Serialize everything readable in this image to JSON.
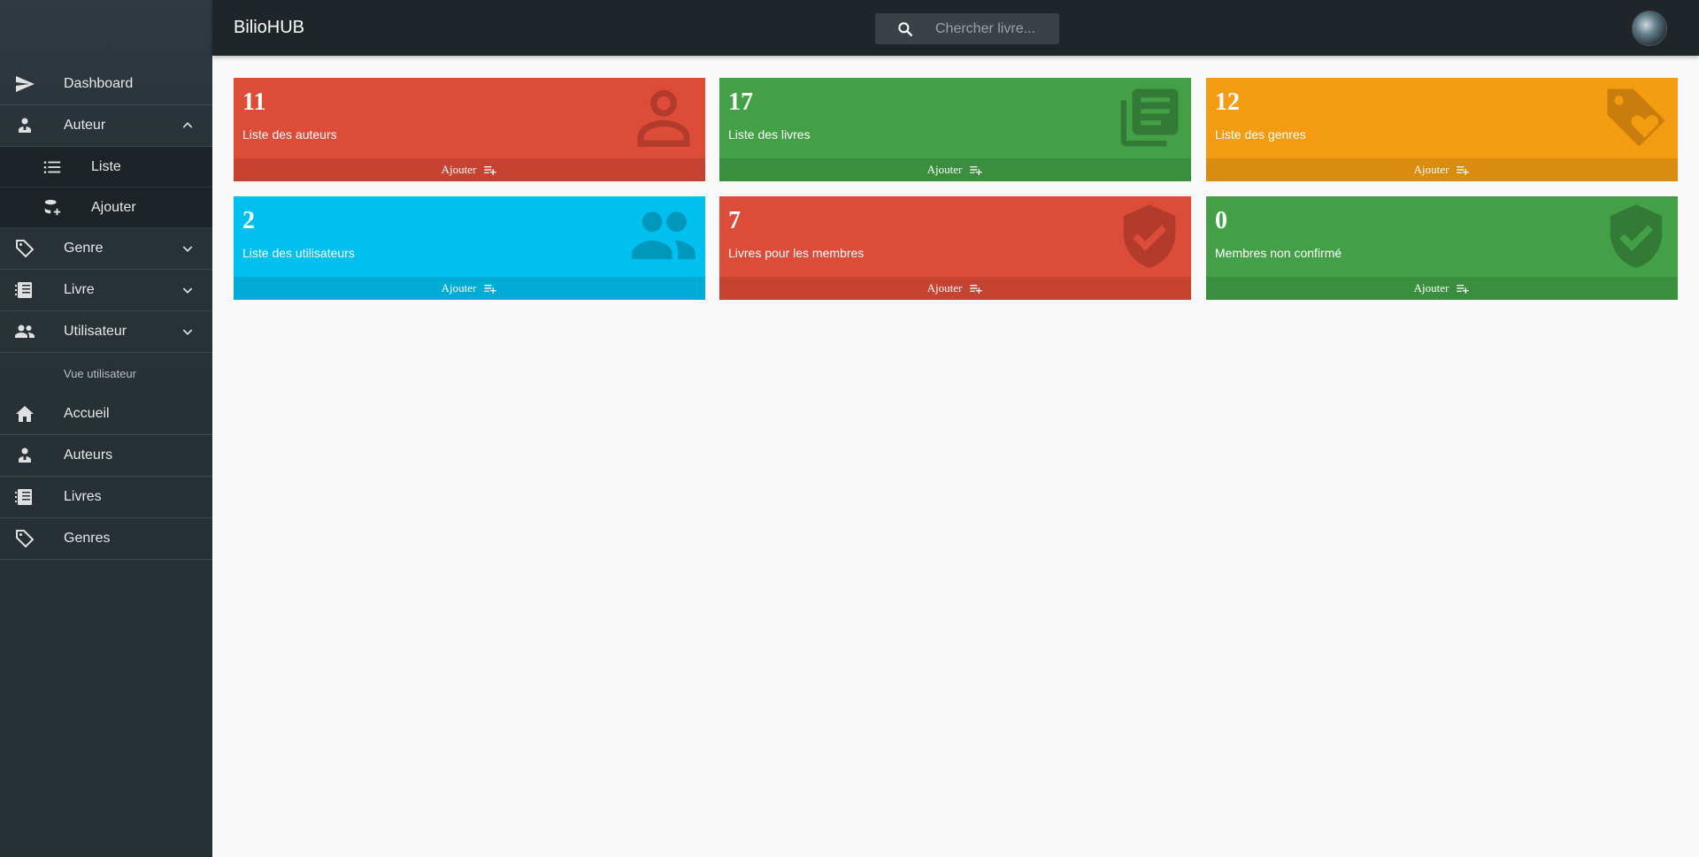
{
  "app": {
    "brand": "BilioHUB"
  },
  "search": {
    "placeholder": "Chercher livre..."
  },
  "sidebar": {
    "items": [
      {
        "label": "Dashboard"
      },
      {
        "label": "Auteur"
      },
      {
        "label": "Liste"
      },
      {
        "label": "Ajouter"
      },
      {
        "label": "Genre"
      },
      {
        "label": "Livre"
      },
      {
        "label": "Utilisateur"
      },
      {
        "label": "Vue utilisateur"
      },
      {
        "label": "Accueil"
      },
      {
        "label": "Auteurs"
      },
      {
        "label": "Livres"
      },
      {
        "label": "Genres"
      }
    ]
  },
  "cards": [
    {
      "count": "11",
      "title": "Liste des auteurs",
      "action": "Ajouter",
      "color": "#dd4b39",
      "icon": "person-icon"
    },
    {
      "count": "17",
      "title": "Liste des livres",
      "action": "Ajouter",
      "color": "#43a047",
      "icon": "library-books-icon"
    },
    {
      "count": "12",
      "title": "Liste des genres",
      "action": "Ajouter",
      "color": "#f39c12",
      "icon": "tag-heart-icon"
    },
    {
      "count": "2",
      "title": "Liste des utilisateurs",
      "action": "Ajouter",
      "color": "#00c0ef",
      "icon": "group-icon"
    },
    {
      "count": "7",
      "title": "Livres pour les membres",
      "action": "Ajouter",
      "color": "#dd4b39",
      "icon": "shield-check-icon"
    },
    {
      "count": "0",
      "title": "Membres non confirmé",
      "action": "Ajouter",
      "color": "#43a047",
      "icon": "shield-check-icon"
    }
  ]
}
